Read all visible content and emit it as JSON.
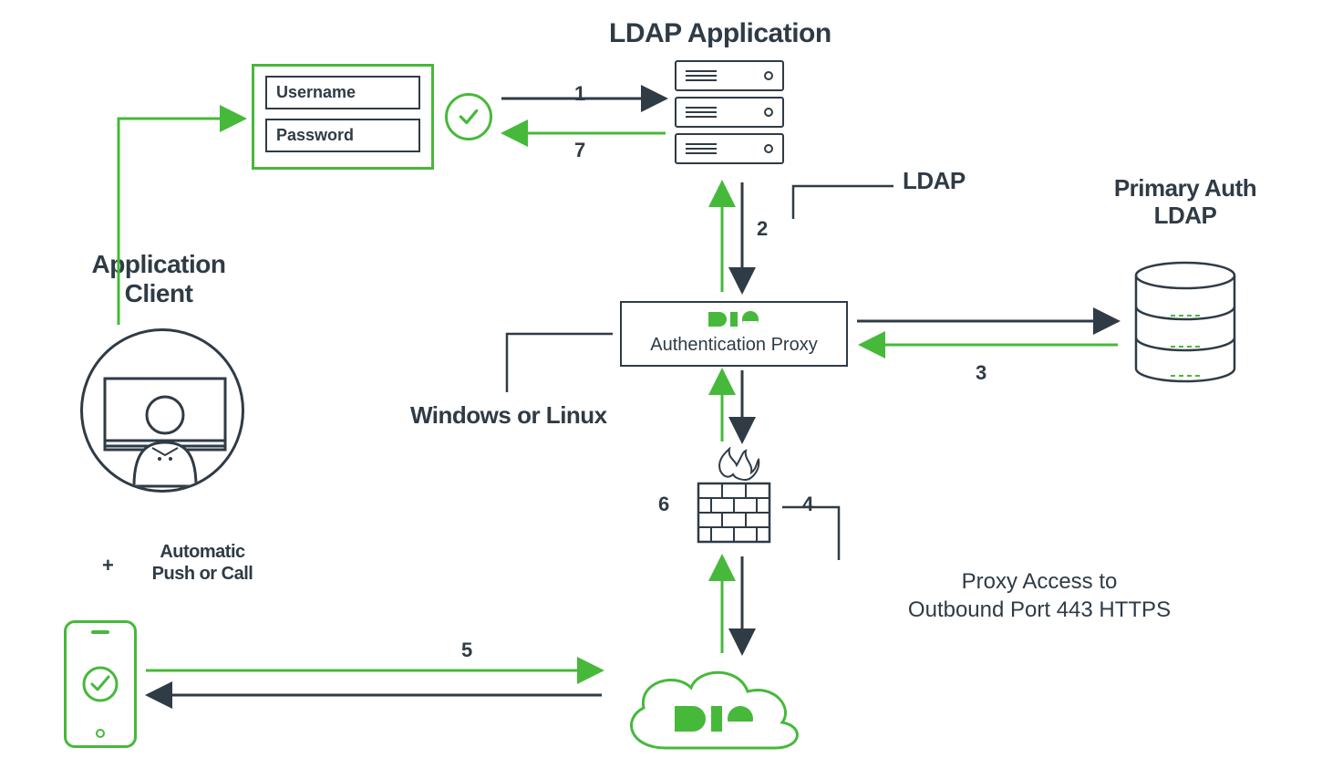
{
  "labels": {
    "ldap_application": "LDAP Application",
    "ldap": "LDAP",
    "primary_auth_ldap_line1": "Primary Auth",
    "primary_auth_ldap_line2": "LDAP",
    "application_client_line1": "Application",
    "application_client_line2": "Client",
    "windows_or_linux": "Windows or Linux",
    "automatic_push_line1": "Automatic",
    "automatic_push_line2": "Push or Call",
    "proxy_access_line1": "Proxy Access to",
    "proxy_access_line2": "Outbound Port 443 HTTPS",
    "authentication_proxy": "Authentication Proxy",
    "duo": "DUO"
  },
  "login": {
    "username": "Username",
    "password": "Password"
  },
  "plus": "+",
  "steps": {
    "s1": "1",
    "s2": "2",
    "s3": "3",
    "s4": "4",
    "s5": "5",
    "s6": "6",
    "s7": "7"
  }
}
